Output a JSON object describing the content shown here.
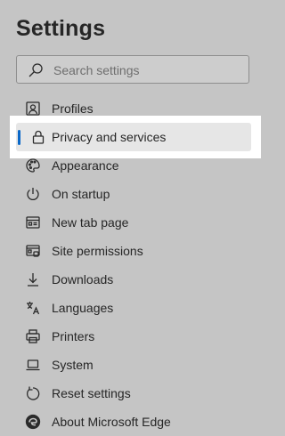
{
  "title": "Settings",
  "search": {
    "placeholder": "Search settings",
    "icon": "search-icon"
  },
  "nav": [
    {
      "label": "Profiles",
      "icon": "profile-icon"
    },
    {
      "label": "Privacy and services",
      "icon": "lock-icon",
      "selected": true
    },
    {
      "label": "Appearance",
      "icon": "palette-icon"
    },
    {
      "label": "On startup",
      "icon": "power-icon"
    },
    {
      "label": "New tab page",
      "icon": "newtab-icon"
    },
    {
      "label": "Site permissions",
      "icon": "site-permissions-icon"
    },
    {
      "label": "Downloads",
      "icon": "download-icon"
    },
    {
      "label": "Languages",
      "icon": "languages-icon"
    },
    {
      "label": "Printers",
      "icon": "printer-icon"
    },
    {
      "label": "System",
      "icon": "laptop-icon"
    },
    {
      "label": "Reset settings",
      "icon": "reset-icon"
    },
    {
      "label": "About Microsoft Edge",
      "icon": "edge-logo-icon"
    }
  ],
  "colors": {
    "accent": "#0a68c8",
    "background": "#c5c5c5",
    "selected": "#e6e6e6"
  }
}
